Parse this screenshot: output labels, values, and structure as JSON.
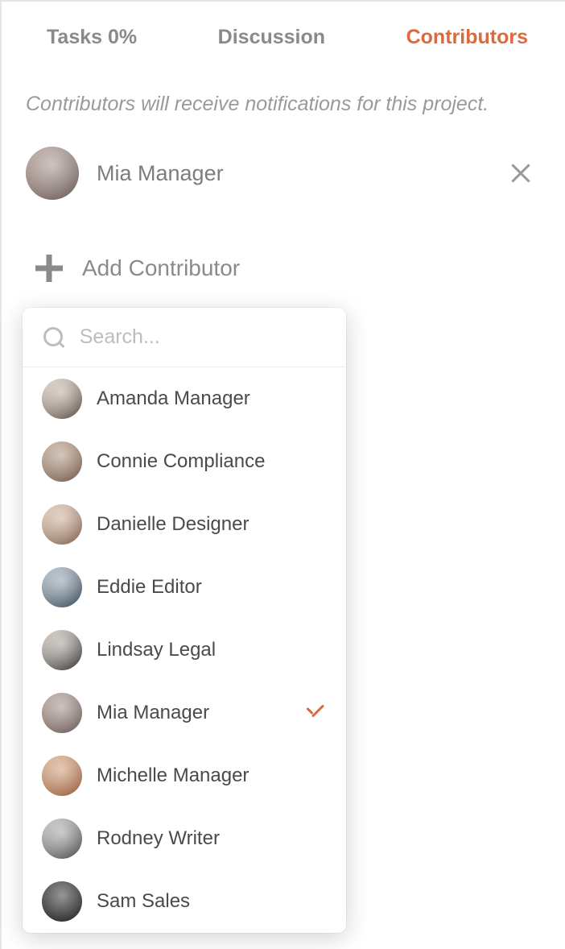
{
  "tabs": {
    "tasks": "Tasks  0%",
    "discussion": "Discussion",
    "contributors": "Contributors"
  },
  "info": "Contributors will receive notifications for this project.",
  "current_contributors": [
    {
      "name": "Mia Manager"
    }
  ],
  "add_label": "Add Contributor",
  "search_placeholder": "Search...",
  "people": [
    {
      "name": "Amanda Manager",
      "selected": false
    },
    {
      "name": "Connie Compliance",
      "selected": false
    },
    {
      "name": "Danielle Designer",
      "selected": false
    },
    {
      "name": "Eddie Editor",
      "selected": false
    },
    {
      "name": "Lindsay Legal",
      "selected": false
    },
    {
      "name": "Mia Manager",
      "selected": true
    },
    {
      "name": "Michelle Manager",
      "selected": false
    },
    {
      "name": "Rodney Writer",
      "selected": false
    },
    {
      "name": "Sam Sales",
      "selected": false
    }
  ],
  "colors": {
    "accent": "#d96b3f",
    "muted": "#8a8a8a"
  }
}
